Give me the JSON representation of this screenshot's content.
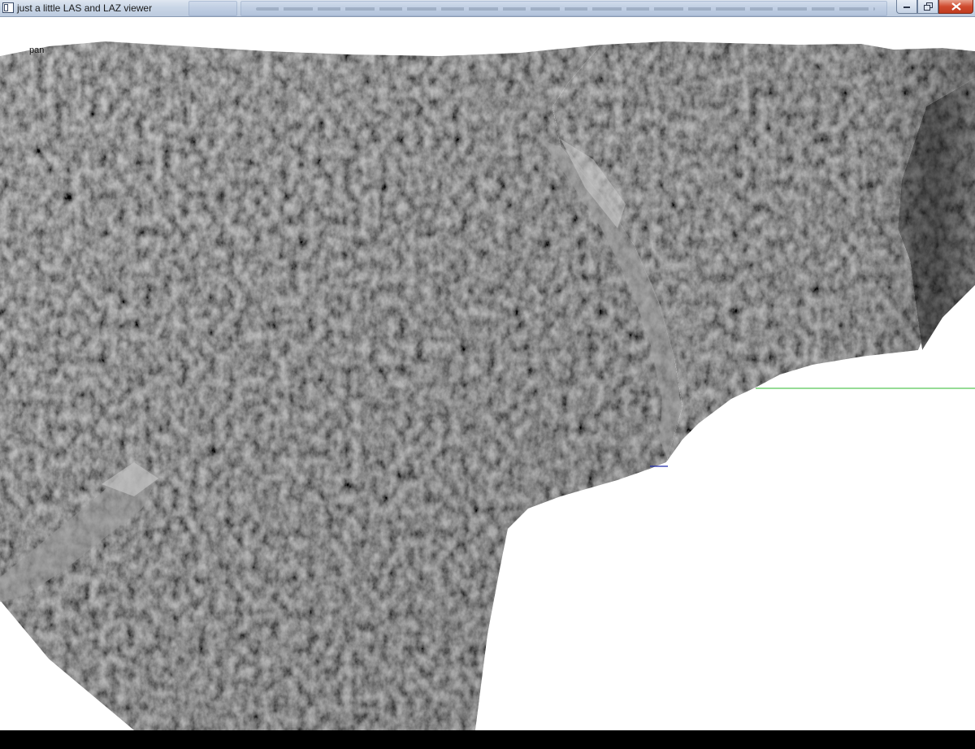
{
  "window": {
    "title": "just a little LAS and LAZ viewer",
    "icon": "window-app-icon",
    "controls": [
      "minimize-icon",
      "restore-icon",
      "close-icon"
    ]
  },
  "viewer": {
    "mode_label": "pan",
    "background_color": "#ffffff",
    "surface_color": "#a8a8a8",
    "axis_line_color": "#2db82d",
    "axis_hint_color": "#1e2aa8"
  }
}
